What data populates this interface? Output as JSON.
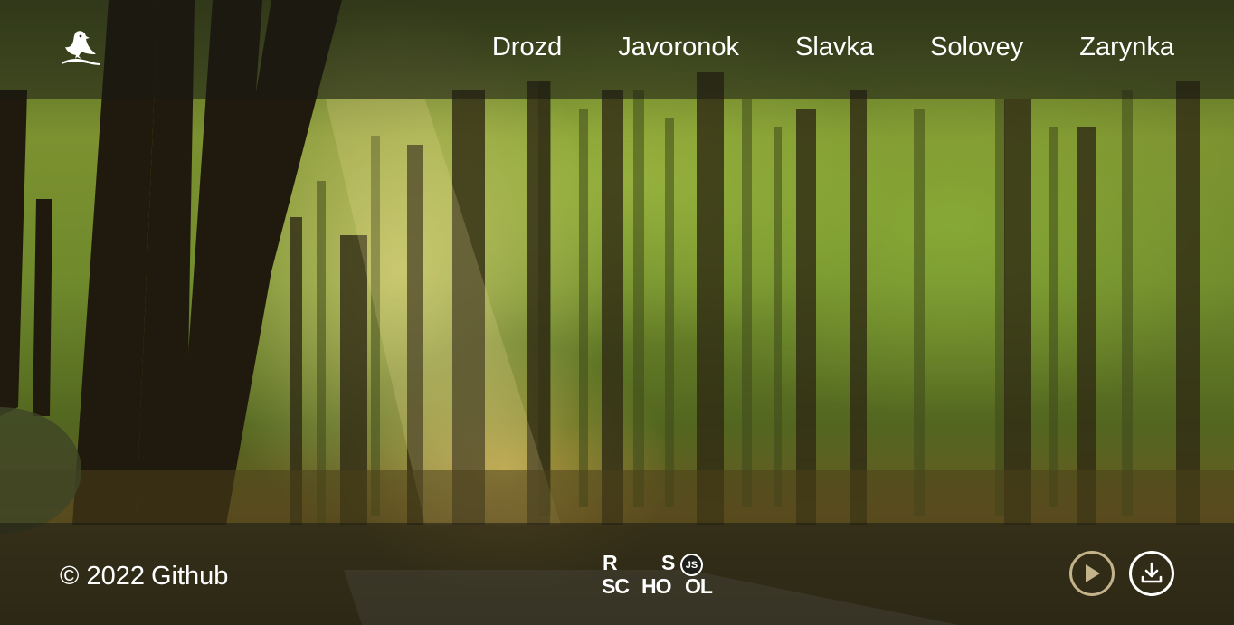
{
  "header": {
    "logo_icon": "bird-icon",
    "nav": [
      {
        "label": "Drozd"
      },
      {
        "label": "Javoronok"
      },
      {
        "label": "Slavka"
      },
      {
        "label": "Solovey"
      },
      {
        "label": "Zarynka"
      }
    ]
  },
  "footer": {
    "copyright_symbol": "©",
    "copyright_year": "2022",
    "copyright_link": "Github",
    "school_logo": {
      "r": "R",
      "s": "S",
      "js": "JS",
      "sc": "SC",
      "ho": "HO",
      "ol": "OL"
    },
    "controls": {
      "play_icon": "play-icon",
      "download_icon": "download-icon",
      "play_color": "#c4b28a",
      "download_color": "#ffffff"
    }
  }
}
